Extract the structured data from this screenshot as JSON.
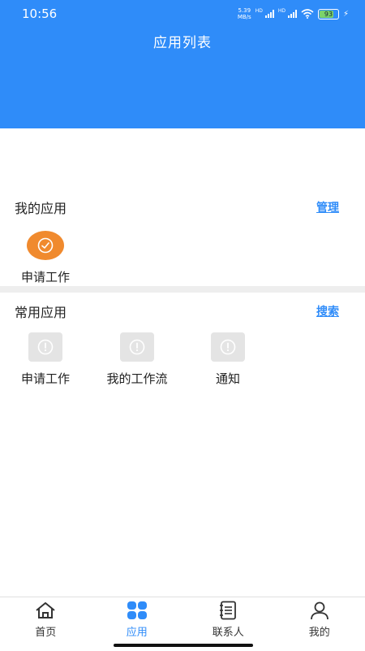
{
  "status_bar": {
    "time": "10:56",
    "net_speed_top": "5.39",
    "net_speed_bottom": "MB/s",
    "hd1": "HD",
    "hd2": "HD",
    "battery": "93"
  },
  "header": {
    "title": "应用列表",
    "color": "#2f8cf9"
  },
  "my_apps": {
    "title": "我的应用",
    "action": "管理",
    "items": [
      {
        "label": "申请工作",
        "icon": "check-circle-icon",
        "color": "#f08a2e"
      }
    ]
  },
  "common_apps": {
    "title": "常用应用",
    "action": "搜索",
    "items": [
      {
        "label": "申请工作",
        "icon": "info-icon"
      },
      {
        "label": "我的工作流",
        "icon": "info-icon"
      },
      {
        "label": "通知",
        "icon": "info-icon"
      }
    ]
  },
  "tabbar": {
    "items": [
      {
        "label": "首页",
        "icon": "home-icon"
      },
      {
        "label": "应用",
        "icon": "apps-grid-icon",
        "active": true
      },
      {
        "label": "联系人",
        "icon": "contacts-book-icon"
      },
      {
        "label": "我的",
        "icon": "user-icon"
      }
    ]
  }
}
